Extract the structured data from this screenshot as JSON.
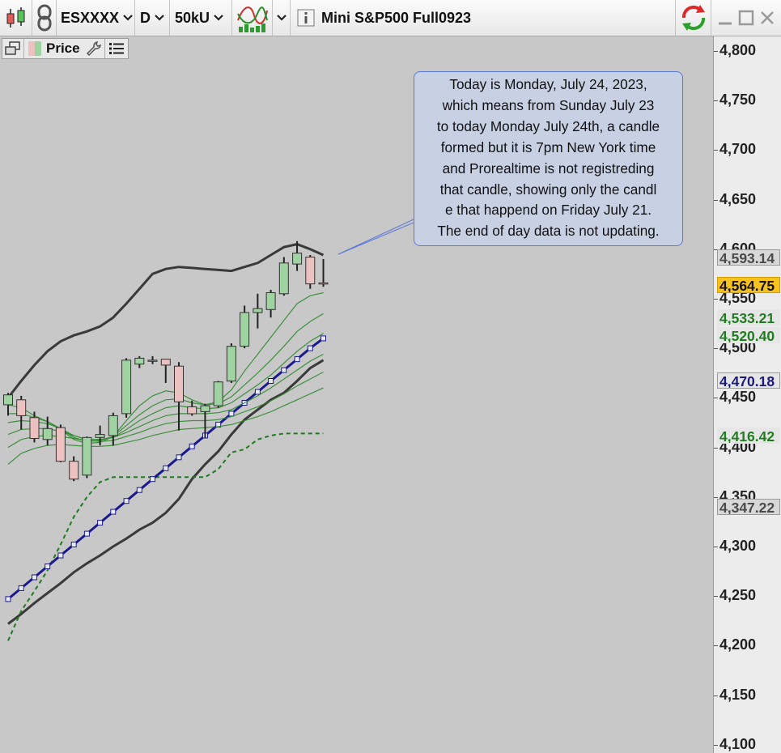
{
  "toolbar": {
    "symbol": "ESXXXX",
    "timeframe": "D",
    "units": "50kU",
    "title": "Mini S&P500 Full0923"
  },
  "panel": {
    "label": "Price"
  },
  "annotation": {
    "lines": [
      "Today is Monday, July 24, 2023,",
      "which means from Sunday July 23",
      "to today Monday July 24th, a candle",
      "formed but it is 7pm New York time",
      "and Prorealtime is not registreding",
      "that candle, showing only the candl",
      "e that happend on Friday  July 21.",
      "The end of day data is not updating."
    ]
  },
  "colors": {
    "up_candle": "#9fd3a2",
    "down_candle": "#ecc2c0",
    "bollinger": "#3a3a3a",
    "ema_ribbon": "#2d8a2d",
    "dotted_line": "#1f7a1f",
    "blue_line": "#1a1a8c",
    "price_badge": "#f7c21e"
  },
  "chart_data": {
    "type": "candlestick",
    "y_axis": {
      "ylim": [
        4095,
        4808
      ],
      "ticks": [
        4800,
        4750,
        4700,
        4650,
        4600,
        4550,
        4500,
        4450,
        4400,
        4350,
        4300,
        4250,
        4200,
        4150,
        4100
      ],
      "tick_labels": [
        "4,800",
        "4,750",
        "4,700",
        "4,650",
        "4,600",
        "4,550",
        "4,500",
        "4,450",
        "4,400",
        "4,350",
        "4,300",
        "4,250",
        "4,200",
        "4,150",
        "4,100"
      ]
    },
    "candles": [
      {
        "o": 4443,
        "h": 4455,
        "l": 4432,
        "c": 4453
      },
      {
        "o": 4448,
        "h": 4452,
        "l": 4418,
        "c": 4432
      },
      {
        "o": 4430,
        "h": 4436,
        "l": 4405,
        "c": 4409
      },
      {
        "o": 4408,
        "h": 4431,
        "l": 4402,
        "c": 4419
      },
      {
        "o": 4420,
        "h": 4423,
        "l": 4385,
        "c": 4386
      },
      {
        "o": 4386,
        "h": 4391,
        "l": 4366,
        "c": 4368
      },
      {
        "o": 4372,
        "h": 4411,
        "l": 4369,
        "c": 4410
      },
      {
        "o": 4410,
        "h": 4422,
        "l": 4402,
        "c": 4413
      },
      {
        "o": 4412,
        "h": 4435,
        "l": 4402,
        "c": 4432
      },
      {
        "o": 4434,
        "h": 4490,
        "l": 4430,
        "c": 4488
      },
      {
        "o": 4484,
        "h": 4492,
        "l": 4480,
        "c": 4490
      },
      {
        "o": 4488,
        "h": 4492,
        "l": 4484,
        "c": 4488
      },
      {
        "o": 4489,
        "h": 4489,
        "l": 4465,
        "c": 4483
      },
      {
        "o": 4482,
        "h": 4486,
        "l": 4417,
        "c": 4446
      },
      {
        "o": 4441,
        "h": 4447,
        "l": 4432,
        "c": 4434
      },
      {
        "o": 4436,
        "h": 4444,
        "l": 4409,
        "c": 4442
      },
      {
        "o": 4442,
        "h": 4467,
        "l": 4440,
        "c": 4466
      },
      {
        "o": 4467,
        "h": 4505,
        "l": 4465,
        "c": 4502
      },
      {
        "o": 4502,
        "h": 4543,
        "l": 4500,
        "c": 4536
      },
      {
        "o": 4536,
        "h": 4555,
        "l": 4520,
        "c": 4540
      },
      {
        "o": 4539,
        "h": 4559,
        "l": 4531,
        "c": 4556
      },
      {
        "o": 4555,
        "h": 4592,
        "l": 4553,
        "c": 4586
      },
      {
        "o": 4585,
        "h": 4608,
        "l": 4578,
        "c": 4596
      },
      {
        "o": 4592,
        "h": 4594,
        "l": 4560,
        "c": 4565
      },
      {
        "o": 4566,
        "h": 4590,
        "l": 4562,
        "c": 4565
      }
    ],
    "overlays": [
      {
        "style": "bollinger",
        "values": [
          4450,
          4467,
          4483,
          4497,
          4507,
          4513,
          4517,
          4522,
          4531,
          4545,
          4560,
          4575,
          4580,
          4582,
          4581,
          4580,
          4579,
          4578,
          4582,
          4586,
          4594,
          4602,
          4605,
          4600,
          4594
        ]
      },
      {
        "style": "bollinger",
        "values": [
          4222,
          4232,
          4243,
          4253,
          4263,
          4274,
          4283,
          4291,
          4300,
          4308,
          4317,
          4324,
          4334,
          4348,
          4368,
          4383,
          4396,
          4413,
          4428,
          4438,
          4448,
          4455,
          4467,
          4480,
          4488
        ]
      },
      {
        "style": "ema",
        "values": [
          4443,
          4440,
          4432,
          4426,
          4418,
          4408,
          4404,
          4405,
          4411,
          4427,
          4442,
          4452,
          4457,
          4455,
          4448,
          4443,
          4446,
          4458,
          4477,
          4494,
          4511,
          4528,
          4545,
          4553,
          4556
        ]
      },
      {
        "style": "ema",
        "values": [
          4434,
          4434,
          4430,
          4426,
          4419,
          4410,
          4406,
          4407,
          4411,
          4422,
          4433,
          4442,
          4448,
          4449,
          4445,
          4443,
          4444,
          4451,
          4463,
          4475,
          4488,
          4502,
          4517,
          4527,
          4535
        ]
      },
      {
        "style": "ema",
        "values": [
          4425,
          4427,
          4426,
          4424,
          4419,
          4412,
          4408,
          4408,
          4410,
          4418,
          4427,
          4434,
          4440,
          4442,
          4440,
          4439,
          4440,
          4445,
          4454,
          4463,
          4473,
          4485,
          4497,
          4507,
          4515
        ]
      },
      {
        "style": "ema",
        "values": [
          4413,
          4418,
          4419,
          4419,
          4416,
          4412,
          4408,
          4408,
          4410,
          4415,
          4421,
          4427,
          4432,
          4434,
          4434,
          4434,
          4435,
          4438,
          4445,
          4452,
          4460,
          4469,
          4478,
          4487,
          4494
        ]
      },
      {
        "style": "ema",
        "values": [
          4400,
          4408,
          4411,
          4412,
          4411,
          4409,
          4407,
          4406,
          4407,
          4411,
          4415,
          4420,
          4424,
          4426,
          4427,
          4427,
          4428,
          4431,
          4436,
          4441,
          4447,
          4454,
          4462,
          4469,
          4476
        ]
      },
      {
        "style": "ema",
        "values": [
          4383,
          4394,
          4399,
          4402,
          4403,
          4402,
          4401,
          4401,
          4402,
          4405,
          4408,
          4412,
          4415,
          4418,
          4419,
          4420,
          4421,
          4423,
          4427,
          4431,
          4436,
          4442,
          4448,
          4454,
          4460
        ]
      },
      {
        "style": "dotted",
        "values": [
          4205,
          4235,
          4255,
          4276,
          4302,
          4330,
          4350,
          4365,
          4370,
          4370,
          4370,
          4370,
          4370,
          4370,
          4370,
          4370,
          4378,
          4395,
          4398,
          4408,
          4412,
          4414,
          4414,
          4414,
          4414
        ]
      },
      {
        "style": "blue_markers",
        "values": [
          4247,
          4258,
          4269,
          4280,
          4291,
          4302,
          4313,
          4324,
          4335,
          4346,
          4357,
          4368,
          4379,
          4390,
          4401,
          4412,
          4423,
          4434,
          4445,
          4456,
          4467,
          4478,
          4489,
          4500,
          4510
        ]
      }
    ],
    "price_labels": [
      {
        "value": 4593.14,
        "text": "4,593.14",
        "style": "grey"
      },
      {
        "value": 4564.75,
        "text": "4,564.75",
        "style": "last"
      },
      {
        "value": 4533.21,
        "text": "4,533.21",
        "style": "green"
      },
      {
        "value": 4520.4,
        "text": "4,520.40",
        "style": "green"
      },
      {
        "value": 4470.18,
        "text": "4,470.18",
        "style": "blue"
      },
      {
        "value": 4416.42,
        "text": "4,416.42",
        "style": "green"
      },
      {
        "value": 4347.22,
        "text": "4,347.22",
        "style": "grey"
      }
    ]
  }
}
